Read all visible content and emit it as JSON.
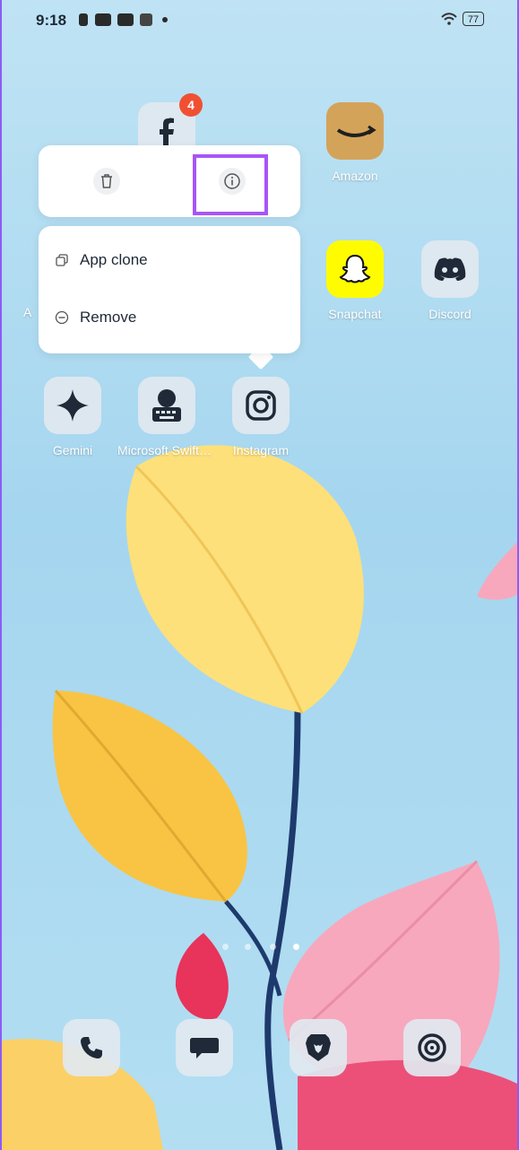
{
  "status_bar": {
    "time": "9:18",
    "battery": "77"
  },
  "popup": {
    "menu": [
      {
        "label": "App clone",
        "icon": "clone-icon"
      },
      {
        "label": "Remove",
        "icon": "remove-icon"
      }
    ]
  },
  "home": {
    "facebook_badge": "4",
    "row1": [
      {
        "label": "Amazon"
      }
    ],
    "row2": [
      {
        "label": "A"
      },
      {
        "label": "Snapchat"
      },
      {
        "label": "Discord"
      }
    ],
    "row3": [
      {
        "label": "Gemini"
      },
      {
        "label": "Microsoft SwiftKey"
      },
      {
        "label": "Instagram"
      }
    ]
  },
  "dock": [
    "phone-icon",
    "messages-icon",
    "brave-icon",
    "camera-icon"
  ],
  "colors": {
    "accent_highlight": "#a855f7",
    "badge": "#f05032",
    "snapchat": "#FFFC00"
  }
}
